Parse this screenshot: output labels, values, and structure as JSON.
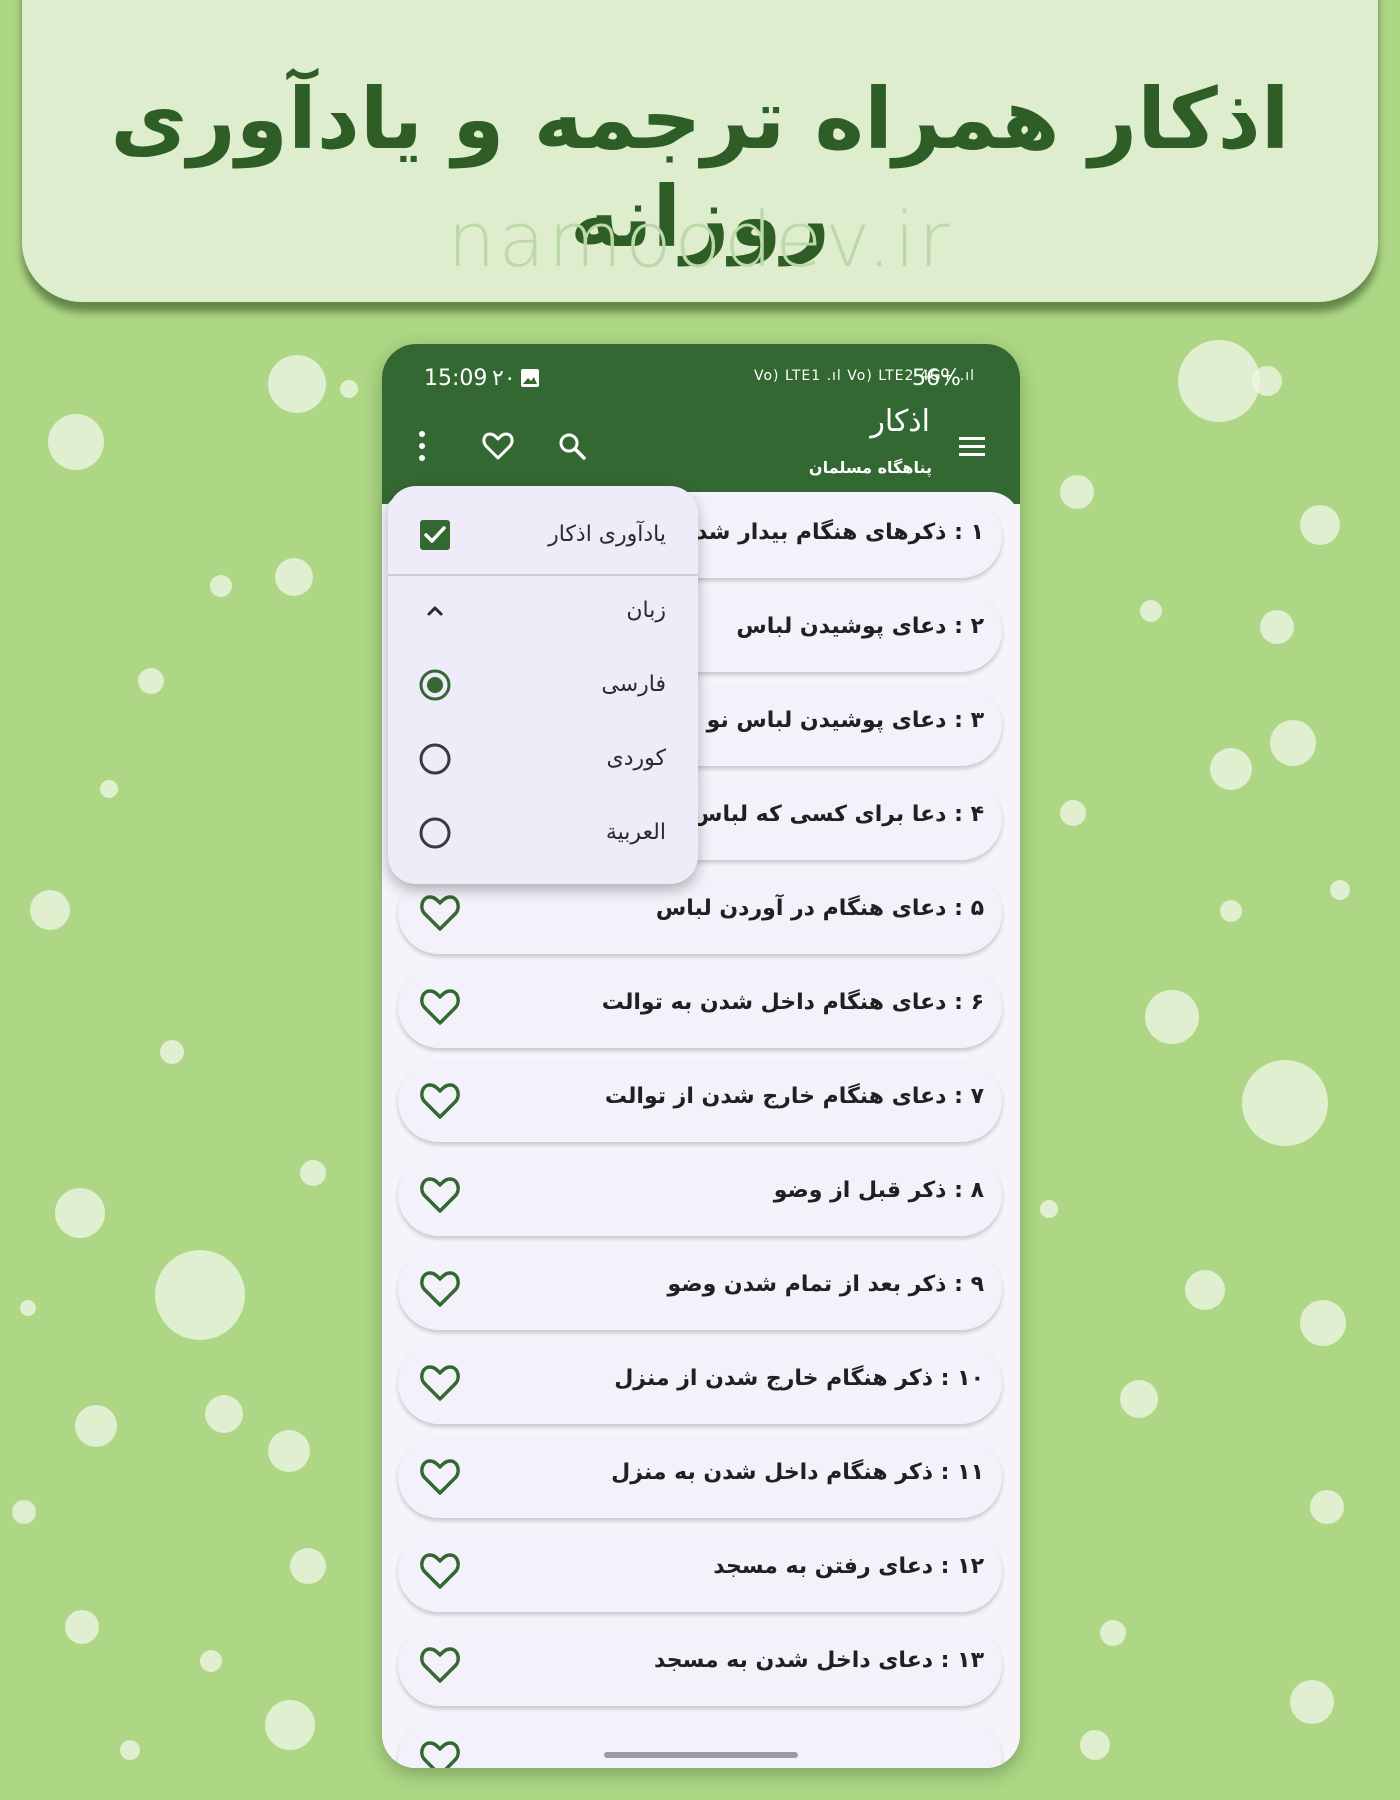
{
  "banner": {
    "title": "اذکار همراه ترجمه و یادآوری روزانه",
    "url": "namoodev.ir"
  },
  "status_bar": {
    "time": "15:09",
    "date": "۲۰",
    "signal": "Vo) LTE1 .ıl Vo) LTE2 4G+ .ıl",
    "battery": "56%"
  },
  "app_bar": {
    "title": "اذکار",
    "subtitle": "پناهگاه مسلمان",
    "icons": [
      "menu-icon",
      "search-icon",
      "heart-icon",
      "more-vert-icon"
    ]
  },
  "menu": {
    "reminder_label": "یادآوری اذکار",
    "reminder_checked": true,
    "language_label": "زبان",
    "options": [
      "فارسی",
      "کوردی",
      "العربية"
    ],
    "selected_option": "فارسی"
  },
  "list": {
    "items": [
      "۱ : ذکرهای هنگام بیدار شدن از",
      "۲ : دعای پوشیدن لباس",
      "۳ : دعای پوشیدن لباس نو",
      "۴ : دعا برای کسی که لباس نو",
      "۵ : دعای هنگام در آوردن لباس",
      "۶ : دعای هنگام داخل شدن به توالت",
      "۷ : دعای هنگام خارج شدن از توالت",
      "۸ : ذکر قبل از وضو",
      "۹ : ذکر بعد از تمام شدن وضو",
      "۱۰ : ذکر هنگام خارج شدن از منزل",
      "۱۱ : ذکر هنگام داخل شدن به منزل",
      "۱۲ : دعای رفتن به مسجد",
      "۱۳ : دعای داخل شدن به مسجد"
    ]
  },
  "colors": {
    "primary": "#346833",
    "background": "#add784",
    "banner": "#dfedcf",
    "banner_text": "#2e5d25"
  }
}
